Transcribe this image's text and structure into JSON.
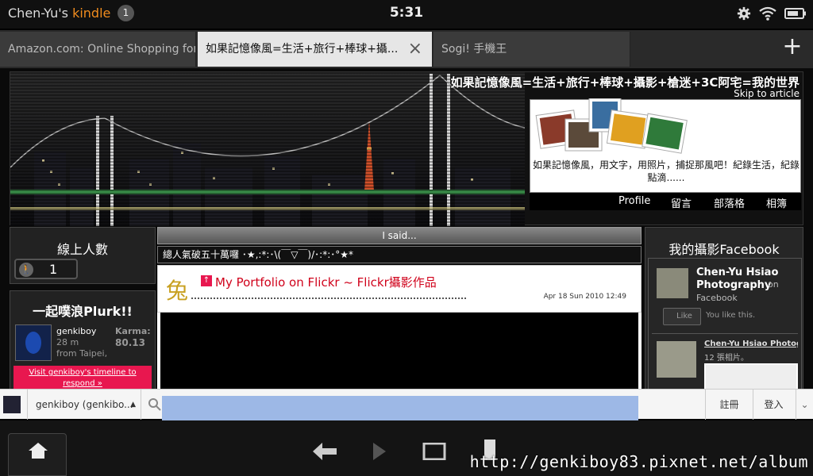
{
  "status_bar": {
    "owner": "Chen-Yu's",
    "brand": "kindle",
    "notification_count": "1",
    "time": "5:31"
  },
  "tabs": [
    {
      "label": "Amazon.com: Online Shopping for..."
    },
    {
      "label": "如果記憶像風=生活+旅行+棒球+攝..."
    },
    {
      "label": "Sogi! 手機王"
    }
  ],
  "blog": {
    "title": "如果記憶像風=生活+旅行+棒球+攝影+槍迷+3C阿宅=我的世界",
    "skip_link": "Skip to article",
    "tagline": "如果記憶像風，用文字，用照片，捕捉那風吧！紀錄生活，紀錄點滴......",
    "nav": [
      "Profile",
      "留言",
      "部落格",
      "相簿"
    ]
  },
  "online": {
    "title": "線上人數",
    "count": "1"
  },
  "plurk": {
    "title": "一起噗浪Plurk!!",
    "user": "genkiboy",
    "age": "28 m",
    "location": "from Taipei,",
    "karma_label": "Karma:",
    "karma_value": "80.13",
    "timeline_link": "Visit genkiboy's timeline to respond »"
  },
  "said": {
    "header": "I said...",
    "text": "總人氣破五十萬囉 ･★,:*:･\\(￣▽￣)/･:*:･°★*"
  },
  "post": {
    "title": "My Portfolio on Flickr ~ Flickr攝影作品",
    "date": "Apr 18 Sun 2010 12:49"
  },
  "facebook": {
    "title": "我的攝影Facebook",
    "page_name": "Chen-Yu Hsiao Photography",
    "on_label": "on",
    "site": "Facebook",
    "like_button": "Like",
    "like_note": "You like this.",
    "album_name": "Chen-Yu Hsiao Photog",
    "album_count": "12 張相片。"
  },
  "find_bar": {
    "tab_label": "genkiboy (genkibo...",
    "register": "註冊",
    "login": "登入"
  },
  "watermark": "http://genkiboy83.pixnet.net/album",
  "colors": {
    "brand": "#f08c1e",
    "post_title": "#d0021b",
    "plurk_link_bg": "#e8174f",
    "find_highlight": "#9db8e6"
  }
}
